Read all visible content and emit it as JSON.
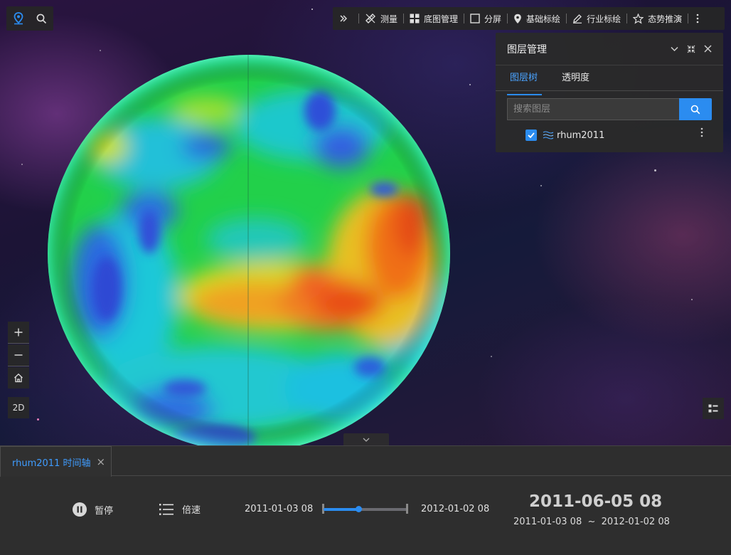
{
  "toolbar": {
    "items": [
      {
        "label": "测量",
        "icon": "ruler-icon"
      },
      {
        "label": "底图管理",
        "icon": "grid-icon"
      },
      {
        "label": "分屏",
        "icon": "square-icon"
      },
      {
        "label": "基础标绘",
        "icon": "map-pin-icon"
      },
      {
        "label": "行业标绘",
        "icon": "pencil-icon"
      },
      {
        "label": "态势推演",
        "icon": "star-icon"
      }
    ]
  },
  "layer_panel": {
    "title": "图层管理",
    "tabs": [
      "图层树",
      "透明度"
    ],
    "active_tab": "图层树",
    "search_placeholder": "搜索图层",
    "layers": [
      {
        "name": "rhum2011",
        "checked": true
      }
    ]
  },
  "nav": {
    "zoom_in": "+",
    "zoom_out": "−",
    "mode_2d": "2D"
  },
  "timeline": {
    "tab_label": "rhum2011 时间轴",
    "pause_label": "暂停",
    "speed_label": "倍速",
    "start_time": "2011-01-03 08",
    "end_time": "2012-01-02 08",
    "current_time": "2011-06-05 08",
    "range_text": "2011-01-03 08  ~  2012-01-02 08",
    "progress": 0.42
  },
  "colors": {
    "accent": "#2b8cf0",
    "panel_bg": "#2a2a2a"
  }
}
